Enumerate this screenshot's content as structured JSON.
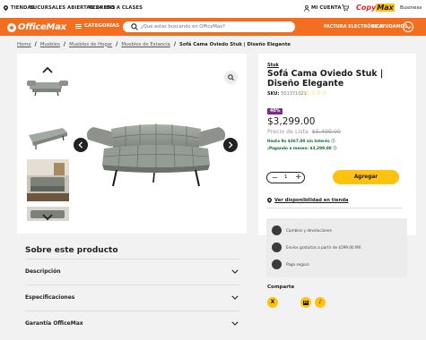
{
  "topbar": {
    "stores": "TIENDAS",
    "open24": "SUCURSALES ABIERTAS 24 HRS",
    "back_to_school": "REGRESO A CLASES",
    "account": "MI CUENTA",
    "brand_copy": "Copy",
    "brand_max": "Max",
    "business": "Business"
  },
  "header": {
    "logo": "OfficeMax",
    "categories": "CATEGORÍAS",
    "search_placeholder": "¿Qué estas buscando en OfficeMax?",
    "invoice": "FACTURA ELECTRÓNICA",
    "help": "TE AYUDAMOS"
  },
  "breadcrumb": [
    "Home",
    "Muebles",
    "Muebles de Hogar",
    "Muebles de Estancia"
  ],
  "breadcrumb_current": "Sofá Cama Oviedo Stuk | Diseño Elegante",
  "product": {
    "brand": "Stuk",
    "title": "Sofá Cama Oviedo Stuk | Diseño Elegante",
    "sku_label": "SKU:",
    "sku": "501371021",
    "rating_stars": "☆☆☆☆☆",
    "discount_badge": "40%",
    "price": "$3,299.00",
    "list_label": "Precio de Lista",
    "list_price": "$5,499.00",
    "msi": "Hasta 9x $367.00 sin Interés ⓘ",
    "monthly": "¡Pagando a meses: $3,299.00 ⓘ",
    "quantity": "1",
    "add_label": "Agregar",
    "availability": "Ver disponibilidad en tienda"
  },
  "services": [
    "Cambios y devoluciones",
    "Envíos gratuitos a partir de $599.00 MX",
    "Pago seguro"
  ],
  "share": {
    "title": "Comparte"
  },
  "about": {
    "title": "Sobre este producto",
    "sections": [
      "Descripción",
      "Especificaciones",
      "Garantía OfficeMax"
    ]
  },
  "colors": {
    "brand_orange": "#f36e21",
    "accent_yellow": "#ffc20e",
    "badge_purple": "#7b2b86",
    "msi_green": "#0b6b30"
  },
  "icons": {
    "sofa": "sofa-image",
    "zoom": "magnifier-icon",
    "prev": "chevron-left-icon",
    "next": "chevron-right-icon"
  }
}
